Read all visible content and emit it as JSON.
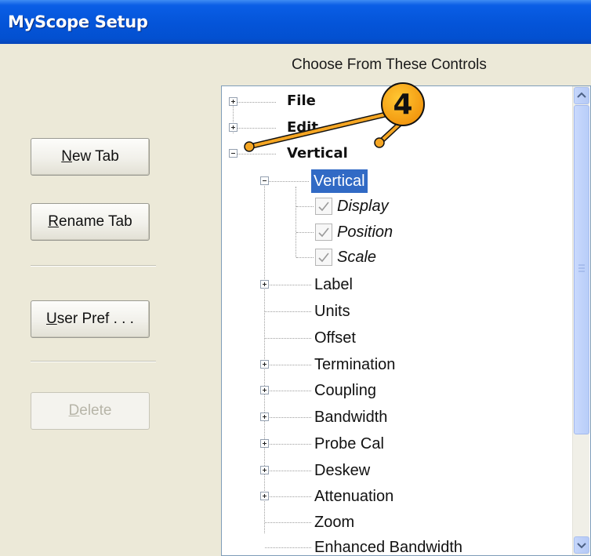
{
  "window": {
    "title": "MyScope Setup"
  },
  "header": {
    "label": "Choose From These Controls"
  },
  "buttons": {
    "new_tab": {
      "mnemonic": "N",
      "rest": "ew Tab"
    },
    "rename_tab": {
      "mnemonic": "R",
      "rest": "ename Tab"
    },
    "user_pref": {
      "mnemonic": "U",
      "rest": "ser Pref . . ."
    },
    "delete": {
      "mnemonic": "D",
      "rest": "elete",
      "enabled": false
    }
  },
  "callout": {
    "number": "4",
    "color": "#f5a623"
  },
  "tree": {
    "selected_color": "#316ac5",
    "items": [
      {
        "label": "File",
        "expander": "plus",
        "bold": true
      },
      {
        "label": "Edit",
        "expander": "plus",
        "bold": true
      },
      {
        "label": "Vertical",
        "expander": "minus",
        "bold": true
      },
      {
        "label": "Vertical",
        "expander": "minus",
        "selected": true
      },
      {
        "label": "Display",
        "checked": true,
        "italic": true
      },
      {
        "label": "Position",
        "checked": true,
        "italic": true
      },
      {
        "label": "Scale",
        "checked": true,
        "italic": true
      },
      {
        "label": "Label",
        "expander": "plus"
      },
      {
        "label": "Units"
      },
      {
        "label": "Offset"
      },
      {
        "label": "Termination",
        "expander": "plus"
      },
      {
        "label": "Coupling",
        "expander": "plus"
      },
      {
        "label": "Bandwidth",
        "expander": "plus"
      },
      {
        "label": "Probe Cal",
        "expander": "plus"
      },
      {
        "label": "Deskew",
        "expander": "plus"
      },
      {
        "label": "Attenuation",
        "expander": "plus"
      },
      {
        "label": "Zoom"
      },
      {
        "label": "Enhanced Bandwidth"
      }
    ]
  }
}
